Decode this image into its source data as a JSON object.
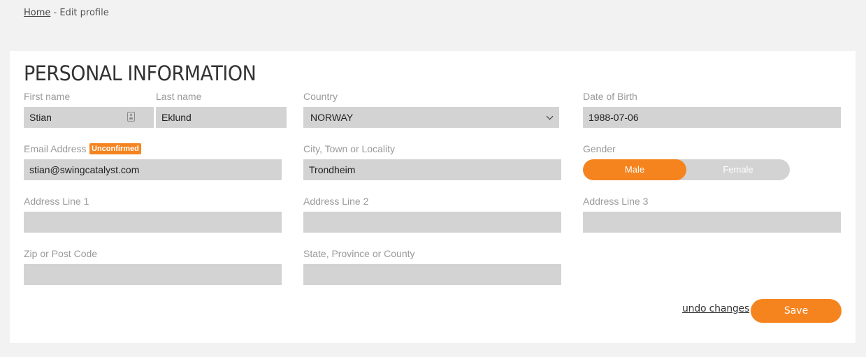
{
  "breadcrumb": {
    "home": "Home",
    "separator": " - ",
    "current": "Edit profile"
  },
  "section_title": "PERSONAL INFORMATION",
  "form": {
    "first_name": {
      "label": "First name",
      "value": "Stian"
    },
    "last_name": {
      "label": "Last name",
      "value": "Eklund"
    },
    "country": {
      "label": "Country",
      "value": "NORWAY"
    },
    "dob": {
      "label": "Date of Birth",
      "value": "1988-07-06"
    },
    "email": {
      "label": "Email Address",
      "badge": "Unconfirmed",
      "value": "stian@swingcatalyst.com"
    },
    "city": {
      "label": "City, Town or Locality",
      "value": "Trondheim"
    },
    "gender": {
      "label": "Gender",
      "options": [
        "Male",
        "Female"
      ],
      "selected": "Male"
    },
    "address1": {
      "label": "Address Line 1",
      "value": ""
    },
    "address2": {
      "label": "Address Line 2",
      "value": ""
    },
    "address3": {
      "label": "Address Line 3",
      "value": ""
    },
    "zip": {
      "label": "Zip or Post Code",
      "value": ""
    },
    "state": {
      "label": "State, Province or County",
      "value": ""
    }
  },
  "actions": {
    "undo_label": "undo changes",
    "save_label": "Save"
  },
  "colors": {
    "accent": "#f5841f",
    "field_bg": "#d3d3d3",
    "page_bg": "#f2f2f2"
  },
  "icons": {
    "first_name_field": "contact-card-icon",
    "country_select": "chevron-down-icon"
  }
}
